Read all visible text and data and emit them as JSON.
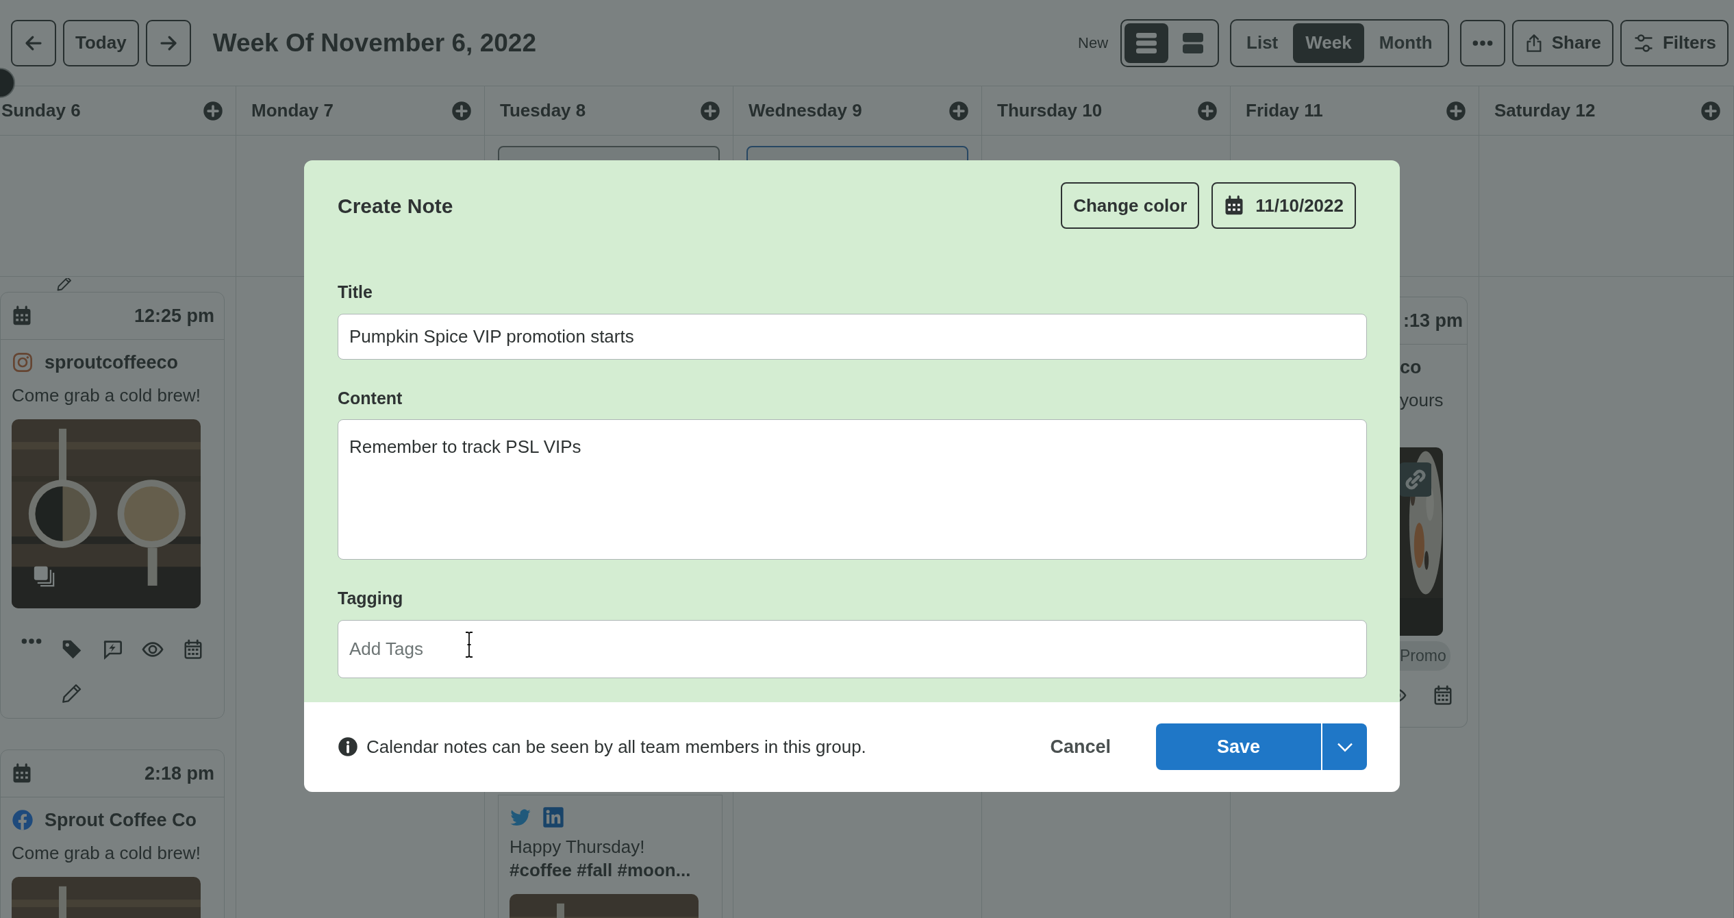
{
  "toolbar": {
    "today": "Today",
    "title": "Week Of November 6, 2022",
    "new_label": "New",
    "layouts": [
      {
        "kind": "rows",
        "selected": true
      },
      {
        "kind": "blocks",
        "selected": false
      }
    ],
    "views": [
      {
        "label": "List",
        "selected": false
      },
      {
        "label": "Week",
        "selected": true
      },
      {
        "label": "Month",
        "selected": false
      }
    ],
    "share": "Share",
    "filters": "Filters"
  },
  "days": [
    {
      "label": "Sunday 6",
      "cards": [
        {
          "kind": "tail"
        },
        {
          "kind": "post",
          "time": "12:25 pm",
          "networks": [
            {
              "kind": "instagram"
            }
          ],
          "account": "sproutcoffeeco",
          "text": "Come grab a cold brew!",
          "picture": {
            "kind": "picture"
          },
          "badge": {
            "kind": "stack"
          },
          "actions": true
        },
        {
          "kind": "post",
          "time": "2:18 pm",
          "networks": [
            {
              "kind": "facebook"
            }
          ],
          "account": "Sprout Coffee Co",
          "text": "Come grab a cold brew!",
          "picture": {
            "kind": "picture"
          }
        }
      ]
    },
    {
      "label": "Monday 7"
    },
    {
      "label": "Tuesday 8",
      "allday": [
        {
          "kind": "peek"
        }
      ],
      "cards": [
        {
          "kind": "lower",
          "networks": [
            {
              "kind": "twitter"
            },
            {
              "kind": "linkedin"
            }
          ],
          "text": "Happy Thursday!",
          "hashtags": "#coffee #fall #moon...",
          "picture": {
            "kind": "picture"
          }
        }
      ]
    },
    {
      "label": "Wednesday 9",
      "allday": [
        {
          "kind": "peek"
        }
      ]
    },
    {
      "label": "Thursday 10"
    },
    {
      "label": "Friday 11",
      "cards": [
        {
          "kind": "clipped",
          "time": ":13 pm",
          "account": "co",
          "text": "yours",
          "picture": {
            "kind": "picture"
          },
          "badge": {
            "kind": "link"
          },
          "tag": "Promo",
          "actions": true
        }
      ]
    },
    {
      "label": "Saturday 12"
    }
  ],
  "modal": {
    "title": "Create Note",
    "change_color": "Change color",
    "date": "11/10/2022",
    "fields": [
      {
        "kind": "input",
        "label": "Title",
        "value": "Pumpkin Spice VIP promotion starts"
      },
      {
        "kind": "textarea",
        "label": "Content",
        "value": "Remember to track PSL VIPs"
      },
      {
        "kind": "tags",
        "label": "Tagging",
        "placeholder": "Add Tags"
      }
    ],
    "info": "Calendar notes can be seen by all team members in this group.",
    "cancel": "Cancel",
    "save": "Save"
  }
}
